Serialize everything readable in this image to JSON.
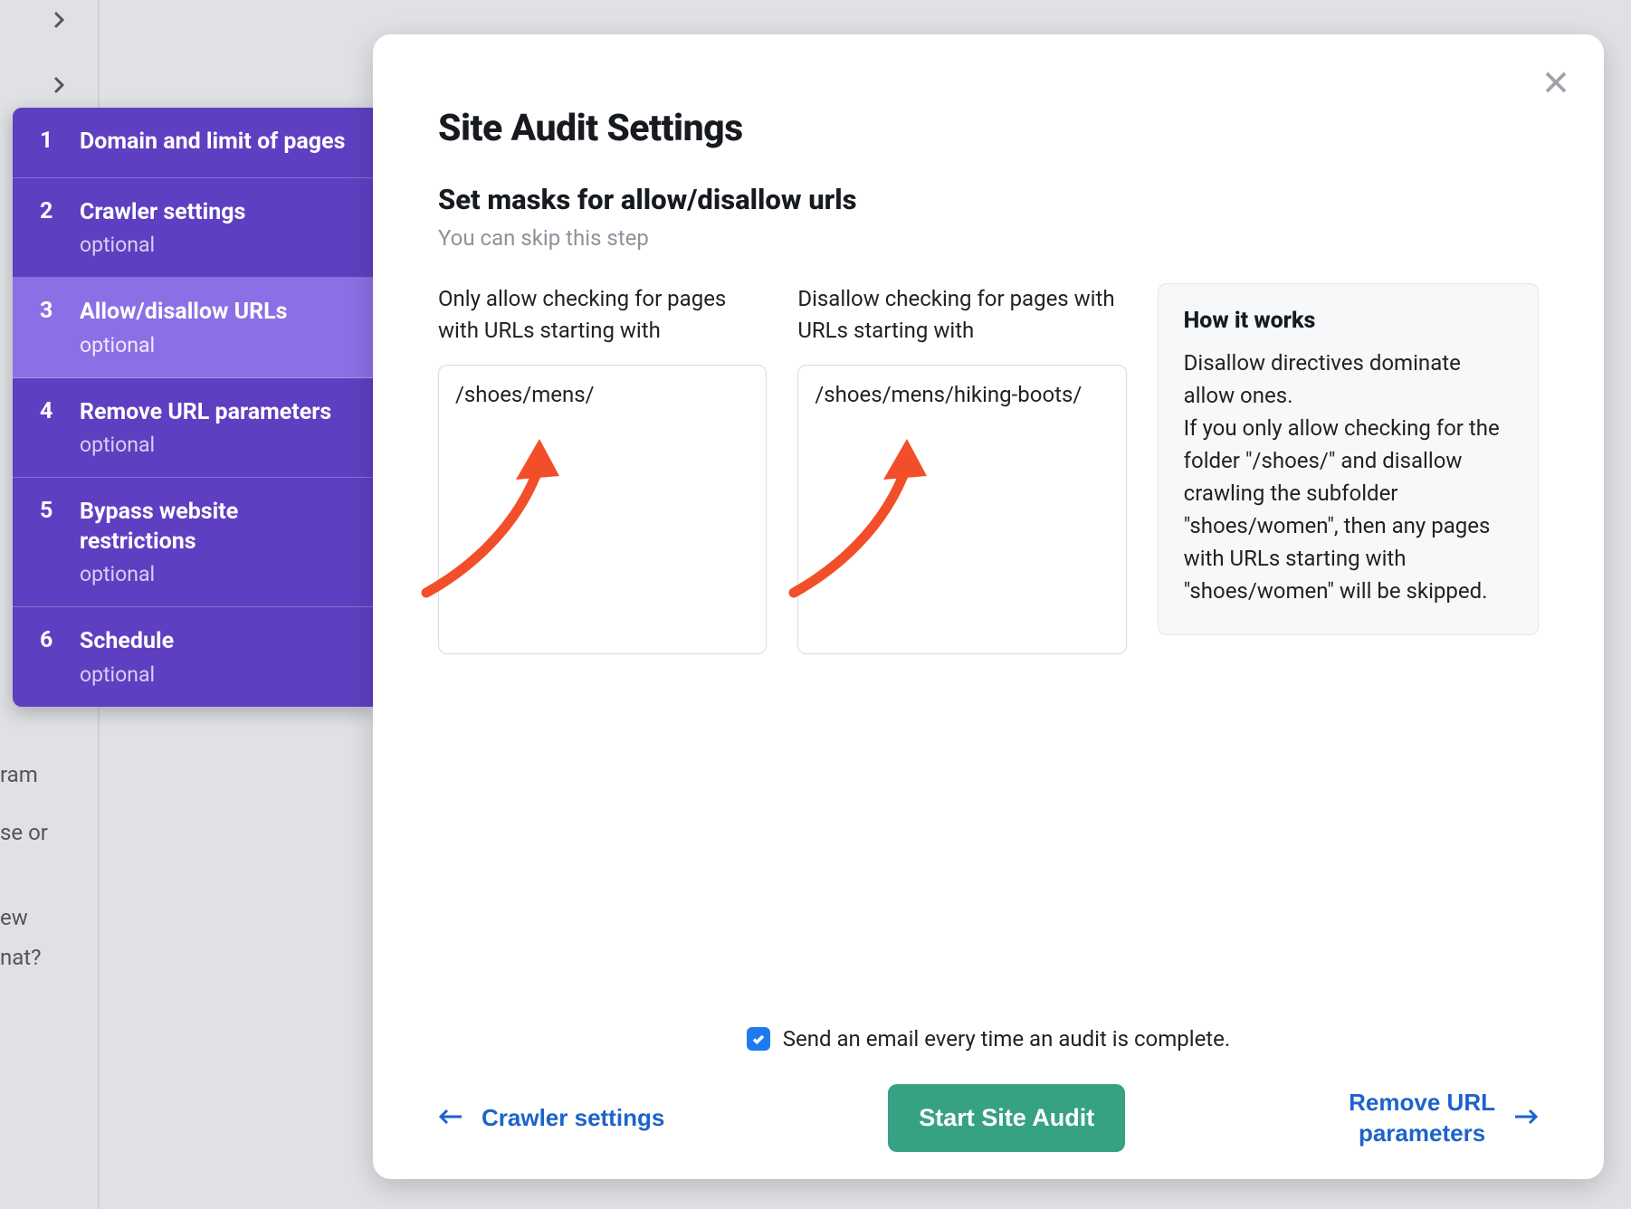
{
  "bg": {
    "t1": "ram",
    "t2": "se or",
    "t3": "ew",
    "t4": "nat?"
  },
  "sidebar": {
    "steps": [
      {
        "num": "1",
        "title": "Domain and limit of pages",
        "optional": ""
      },
      {
        "num": "2",
        "title": "Crawler settings",
        "optional": "optional"
      },
      {
        "num": "3",
        "title": "Allow/disallow URLs",
        "optional": "optional"
      },
      {
        "num": "4",
        "title": "Remove URL parameters",
        "optional": "optional"
      },
      {
        "num": "5",
        "title": "Bypass website restrictions",
        "optional": "optional"
      },
      {
        "num": "6",
        "title": "Schedule",
        "optional": "optional"
      }
    ],
    "active_index": 2
  },
  "modal": {
    "title": "Site Audit Settings",
    "section_title": "Set masks for allow/disallow urls",
    "skip_hint": "You can skip this step",
    "allow_label": "Only allow checking for pages with URLs starting with",
    "disallow_label": "Disallow checking for pages with URLs starting with",
    "allow_value": "/shoes/mens/",
    "disallow_value": "/shoes/mens/hiking-boots/",
    "info_title": "How it works",
    "info_p1": "Disallow directives dominate allow ones.",
    "info_p2": "If you only allow checking for the folder \"/shoes/\" and disallow crawling the subfolder \"shoes/women\", then any pages with URLs starting with \"shoes/women\" will be skipped."
  },
  "footer": {
    "email_label": "Send an email every time an audit is complete.",
    "email_checked": true,
    "back_label": "Crawler settings",
    "primary_label": "Start Site Audit",
    "next_label_line1": "Remove URL",
    "next_label_line2": "parameters"
  }
}
